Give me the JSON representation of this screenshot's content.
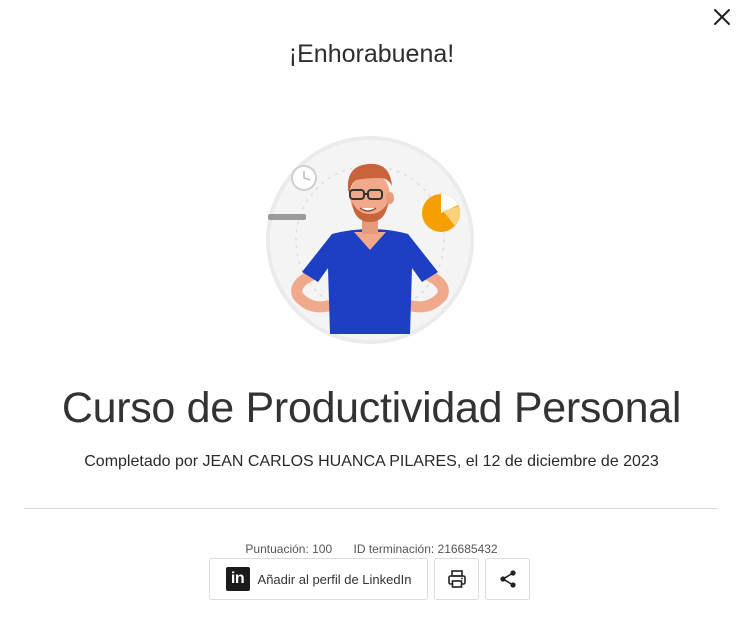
{
  "dialog": {
    "title": "¡Enhorabuena!",
    "close_icon": "close-icon"
  },
  "course": {
    "name": "Curso de Productividad Personal",
    "completed_by": "Completado por JEAN CARLOS HUANCA PILARES, el 12 de diciembre de 2023"
  },
  "meta": {
    "score": "Puntuación: 100",
    "completion_id": "ID terminación: 216685432"
  },
  "actions": {
    "linkedin_logo_text": "in",
    "linkedin_label": "Añadir al perfil de LinkedIn",
    "print_icon": "printer-icon",
    "share_icon": "share-icon"
  },
  "colors": {
    "shirt": "#1c3fc4",
    "hair": "#c8643c",
    "skin": "#f0a98a",
    "pie_accent": "#f5a000",
    "circle_bg": "#f2f2f2"
  }
}
